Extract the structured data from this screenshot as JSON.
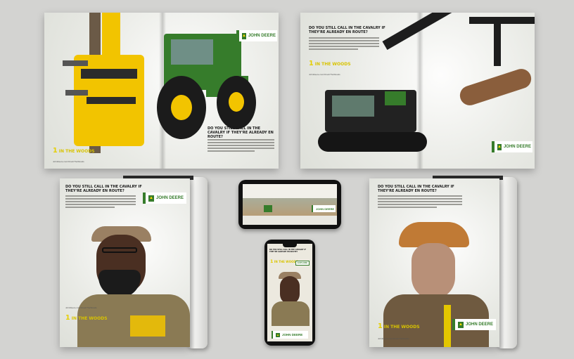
{
  "colors": {
    "background": "#d3d3d1",
    "jd_green": "#367c2b",
    "jd_yellow": "#ffde00",
    "tagline_yellow": "#d8c300"
  },
  "brand": {
    "name": "JOHN DEERE",
    "logo_icon": "leaping-deer-icon"
  },
  "headline": "DO YOU STILL CALL IN THE CAVALRY IF THEY'RE ALREADY EN ROUTE?",
  "tagline": {
    "number": "1",
    "text": "IN THE WOODS"
  },
  "url": "JohnDeere.com/OneInTheWoods",
  "phone_cta": "EXPLORE"
}
